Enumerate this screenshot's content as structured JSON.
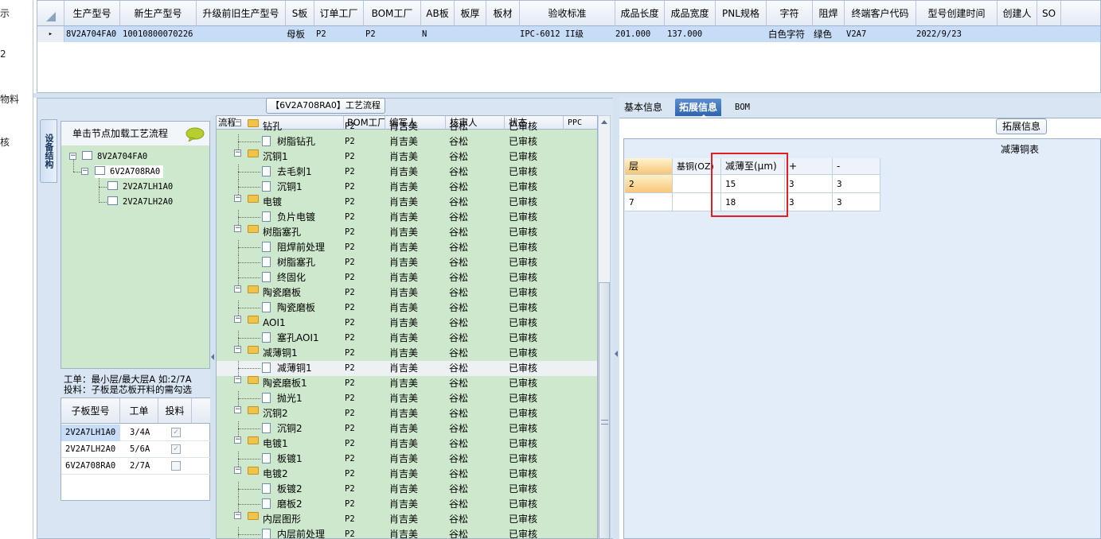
{
  "stub_labels": [
    "示",
    "2",
    "物料",
    "核"
  ],
  "top_grid": {
    "columns": [
      "生产型号",
      "新生产型号",
      "升级前旧生产型号",
      "S板",
      "订单工厂",
      "BOM工厂",
      "AB板",
      "板厚",
      "板材",
      "验收标准",
      "成品长度",
      "成品宽度",
      "PNL规格",
      "字符",
      "阻焊",
      "终端客户代码",
      "型号创建时间",
      "创建人",
      "SO"
    ],
    "row": {
      "marker": "▸",
      "model": "8V2A704FA0",
      "new_model": "10010800070226",
      "board_type": "母板",
      "order_factory": "P2",
      "bom_factory": "P2",
      "ab_board": "N",
      "standard": "IPC-6012 II级",
      "length": "201.000",
      "width": "137.000",
      "char": "白色字符",
      "solder_mask": "绿色",
      "customer_code": "V2A7",
      "created": "2022/9/23"
    }
  },
  "flow_title": "【6V2A708RA0】工艺流程",
  "side_tab": "设备结构",
  "tree_panel": {
    "header": "单击节点加载工艺流程",
    "nodes": [
      "8V2A704FA0",
      "6V2A708RA0",
      "2V2A7LH1A0",
      "2V2A7LH2A0"
    ]
  },
  "note": {
    "line1": "工单：最小层/最大层A 如:2/7A",
    "line2": "投料：子板是芯板开料的需勾选"
  },
  "sub_table": {
    "columns": [
      "子板型号",
      "工单",
      "投料"
    ],
    "rows": [
      {
        "model": "2V2A7LH1A0",
        "order": "3/4A",
        "checked": true
      },
      {
        "model": "2V2A7LH2A0",
        "order": "5/6A",
        "checked": true
      },
      {
        "model": "6V2A708RA0",
        "order": "2/7A",
        "checked": false
      }
    ]
  },
  "flow_grid": {
    "columns": [
      "流程",
      "BOM工厂",
      "编写人",
      "核审人",
      "状态",
      "PPC"
    ],
    "rows": [
      {
        "kind": "group",
        "name": "钻孔",
        "factory": "P2",
        "writer": "肖吉美",
        "reviewer": "谷松",
        "status": "已审核"
      },
      {
        "kind": "step",
        "name": "树脂钻孔",
        "factory": "P2",
        "writer": "肖吉美",
        "reviewer": "谷松",
        "status": "已审核"
      },
      {
        "kind": "group",
        "name": "沉铜1",
        "factory": "P2",
        "writer": "肖吉美",
        "reviewer": "谷松",
        "status": "已审核"
      },
      {
        "kind": "step",
        "name": "去毛刺1",
        "factory": "P2",
        "writer": "肖吉美",
        "reviewer": "谷松",
        "status": "已审核"
      },
      {
        "kind": "step",
        "name": "沉铜1",
        "factory": "P2",
        "writer": "肖吉美",
        "reviewer": "谷松",
        "status": "已审核"
      },
      {
        "kind": "group",
        "name": "电镀",
        "factory": "P2",
        "writer": "肖吉美",
        "reviewer": "谷松",
        "status": "已审核"
      },
      {
        "kind": "step",
        "name": "负片电镀",
        "factory": "P2",
        "writer": "肖吉美",
        "reviewer": "谷松",
        "status": "已审核"
      },
      {
        "kind": "group",
        "name": "树脂塞孔",
        "factory": "P2",
        "writer": "肖吉美",
        "reviewer": "谷松",
        "status": "已审核"
      },
      {
        "kind": "step",
        "name": "阻焊前处理",
        "factory": "P2",
        "writer": "肖吉美",
        "reviewer": "谷松",
        "status": "已审核"
      },
      {
        "kind": "step",
        "name": "树脂塞孔",
        "factory": "P2",
        "writer": "肖吉美",
        "reviewer": "谷松",
        "status": "已审核"
      },
      {
        "kind": "step",
        "name": "终固化",
        "factory": "P2",
        "writer": "肖吉美",
        "reviewer": "谷松",
        "status": "已审核"
      },
      {
        "kind": "group",
        "name": "陶瓷磨板",
        "factory": "P2",
        "writer": "肖吉美",
        "reviewer": "谷松",
        "status": "已审核"
      },
      {
        "kind": "step",
        "name": "陶瓷磨板",
        "factory": "P2",
        "writer": "肖吉美",
        "reviewer": "谷松",
        "status": "已审核"
      },
      {
        "kind": "group",
        "name": "AOI1",
        "factory": "P2",
        "writer": "肖吉美",
        "reviewer": "谷松",
        "status": "已审核"
      },
      {
        "kind": "step",
        "name": "塞孔AOI1",
        "factory": "P2",
        "writer": "肖吉美",
        "reviewer": "谷松",
        "status": "已审核"
      },
      {
        "kind": "group",
        "name": "减薄铜1",
        "factory": "P2",
        "writer": "肖吉美",
        "reviewer": "谷松",
        "status": "已审核"
      },
      {
        "kind": "step",
        "name": "减薄铜1",
        "factory": "P2",
        "writer": "肖吉美",
        "reviewer": "谷松",
        "status": "已审核",
        "selected": true
      },
      {
        "kind": "group",
        "name": "陶瓷磨板1",
        "factory": "P2",
        "writer": "肖吉美",
        "reviewer": "谷松",
        "status": "已审核"
      },
      {
        "kind": "step",
        "name": "抛光1",
        "factory": "P2",
        "writer": "肖吉美",
        "reviewer": "谷松",
        "status": "已审核"
      },
      {
        "kind": "group",
        "name": "沉铜2",
        "factory": "P2",
        "writer": "肖吉美",
        "reviewer": "谷松",
        "status": "已审核"
      },
      {
        "kind": "step",
        "name": "沉铜2",
        "factory": "P2",
        "writer": "肖吉美",
        "reviewer": "谷松",
        "status": "已审核"
      },
      {
        "kind": "group",
        "name": "电镀1",
        "factory": "P2",
        "writer": "肖吉美",
        "reviewer": "谷松",
        "status": "已审核"
      },
      {
        "kind": "step",
        "name": "板镀1",
        "factory": "P2",
        "writer": "肖吉美",
        "reviewer": "谷松",
        "status": "已审核"
      },
      {
        "kind": "group",
        "name": "电镀2",
        "factory": "P2",
        "writer": "肖吉美",
        "reviewer": "谷松",
        "status": "已审核"
      },
      {
        "kind": "step",
        "name": "板镀2",
        "factory": "P2",
        "writer": "肖吉美",
        "reviewer": "谷松",
        "status": "已审核"
      },
      {
        "kind": "step",
        "name": "磨板2",
        "factory": "P2",
        "writer": "肖吉美",
        "reviewer": "谷松",
        "status": "已审核"
      },
      {
        "kind": "group",
        "name": "内层图形",
        "factory": "P2",
        "writer": "肖吉美",
        "reviewer": "谷松",
        "status": "已审核"
      },
      {
        "kind": "step",
        "name": "内层前处理",
        "factory": "P2",
        "writer": "肖吉美",
        "reviewer": "谷松",
        "status": "已审核"
      }
    ]
  },
  "right_tabs": [
    "基本信息",
    "拓展信息",
    "BOM"
  ],
  "ext_label": "拓展信息",
  "table_caption": "减薄铜表",
  "thin_table": {
    "columns": [
      "层",
      "基铜(OZ)",
      "减薄至(μm)",
      "+",
      "-"
    ],
    "rows": [
      [
        "2",
        "",
        "15",
        "3",
        "3"
      ],
      [
        "7",
        "",
        "18",
        "3",
        "3"
      ]
    ]
  },
  "colors": {
    "selection": "#c7dcf6",
    "flow_bg": "#cde8cc",
    "highlight": "#e02020",
    "active_tab": "#2d64ad"
  }
}
